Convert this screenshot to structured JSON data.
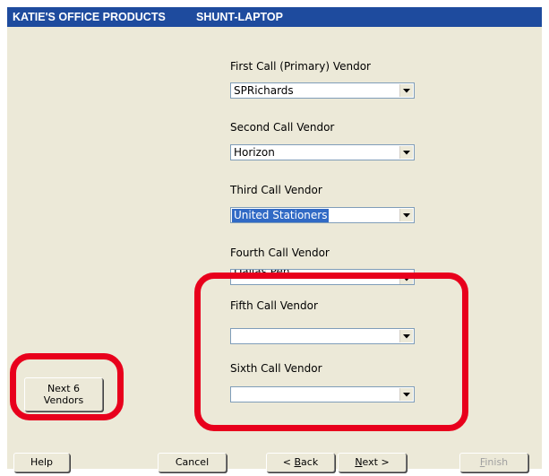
{
  "header": {
    "company": "KATIE'S OFFICE PRODUCTS",
    "computer": "SHUNT-LAPTOP"
  },
  "vendors": [
    {
      "label": "First Call (Primary) Vendor",
      "value": "SPRichards"
    },
    {
      "label": "Second Call Vendor",
      "value": "Horizon"
    },
    {
      "label": "Third Call Vendor",
      "value": "United Stationers",
      "selected": true
    },
    {
      "label": "Fourth Call Vendor",
      "value": "Dallas Pen"
    },
    {
      "label": "Fifth Call Vendor",
      "value": ""
    },
    {
      "label": "Sixth Call Vendor",
      "value": ""
    }
  ],
  "buttons": {
    "next6_line1": "Next 6",
    "next6_line2": "Vendors",
    "help": "Help",
    "cancel": "Cancel",
    "back_prefix": "< ",
    "back_accel": "B",
    "back_rest": "ack",
    "next_accel": "N",
    "next_rest": "ext >",
    "finish_accel": "F",
    "finish_rest": "inish"
  },
  "colors": {
    "header_bg": "#1e4b9e",
    "panel_bg": "#ece9d8",
    "highlight": "#e8001c",
    "selection": "#316ac5"
  },
  "icons": {
    "dropdown": "chevron-down-icon"
  }
}
